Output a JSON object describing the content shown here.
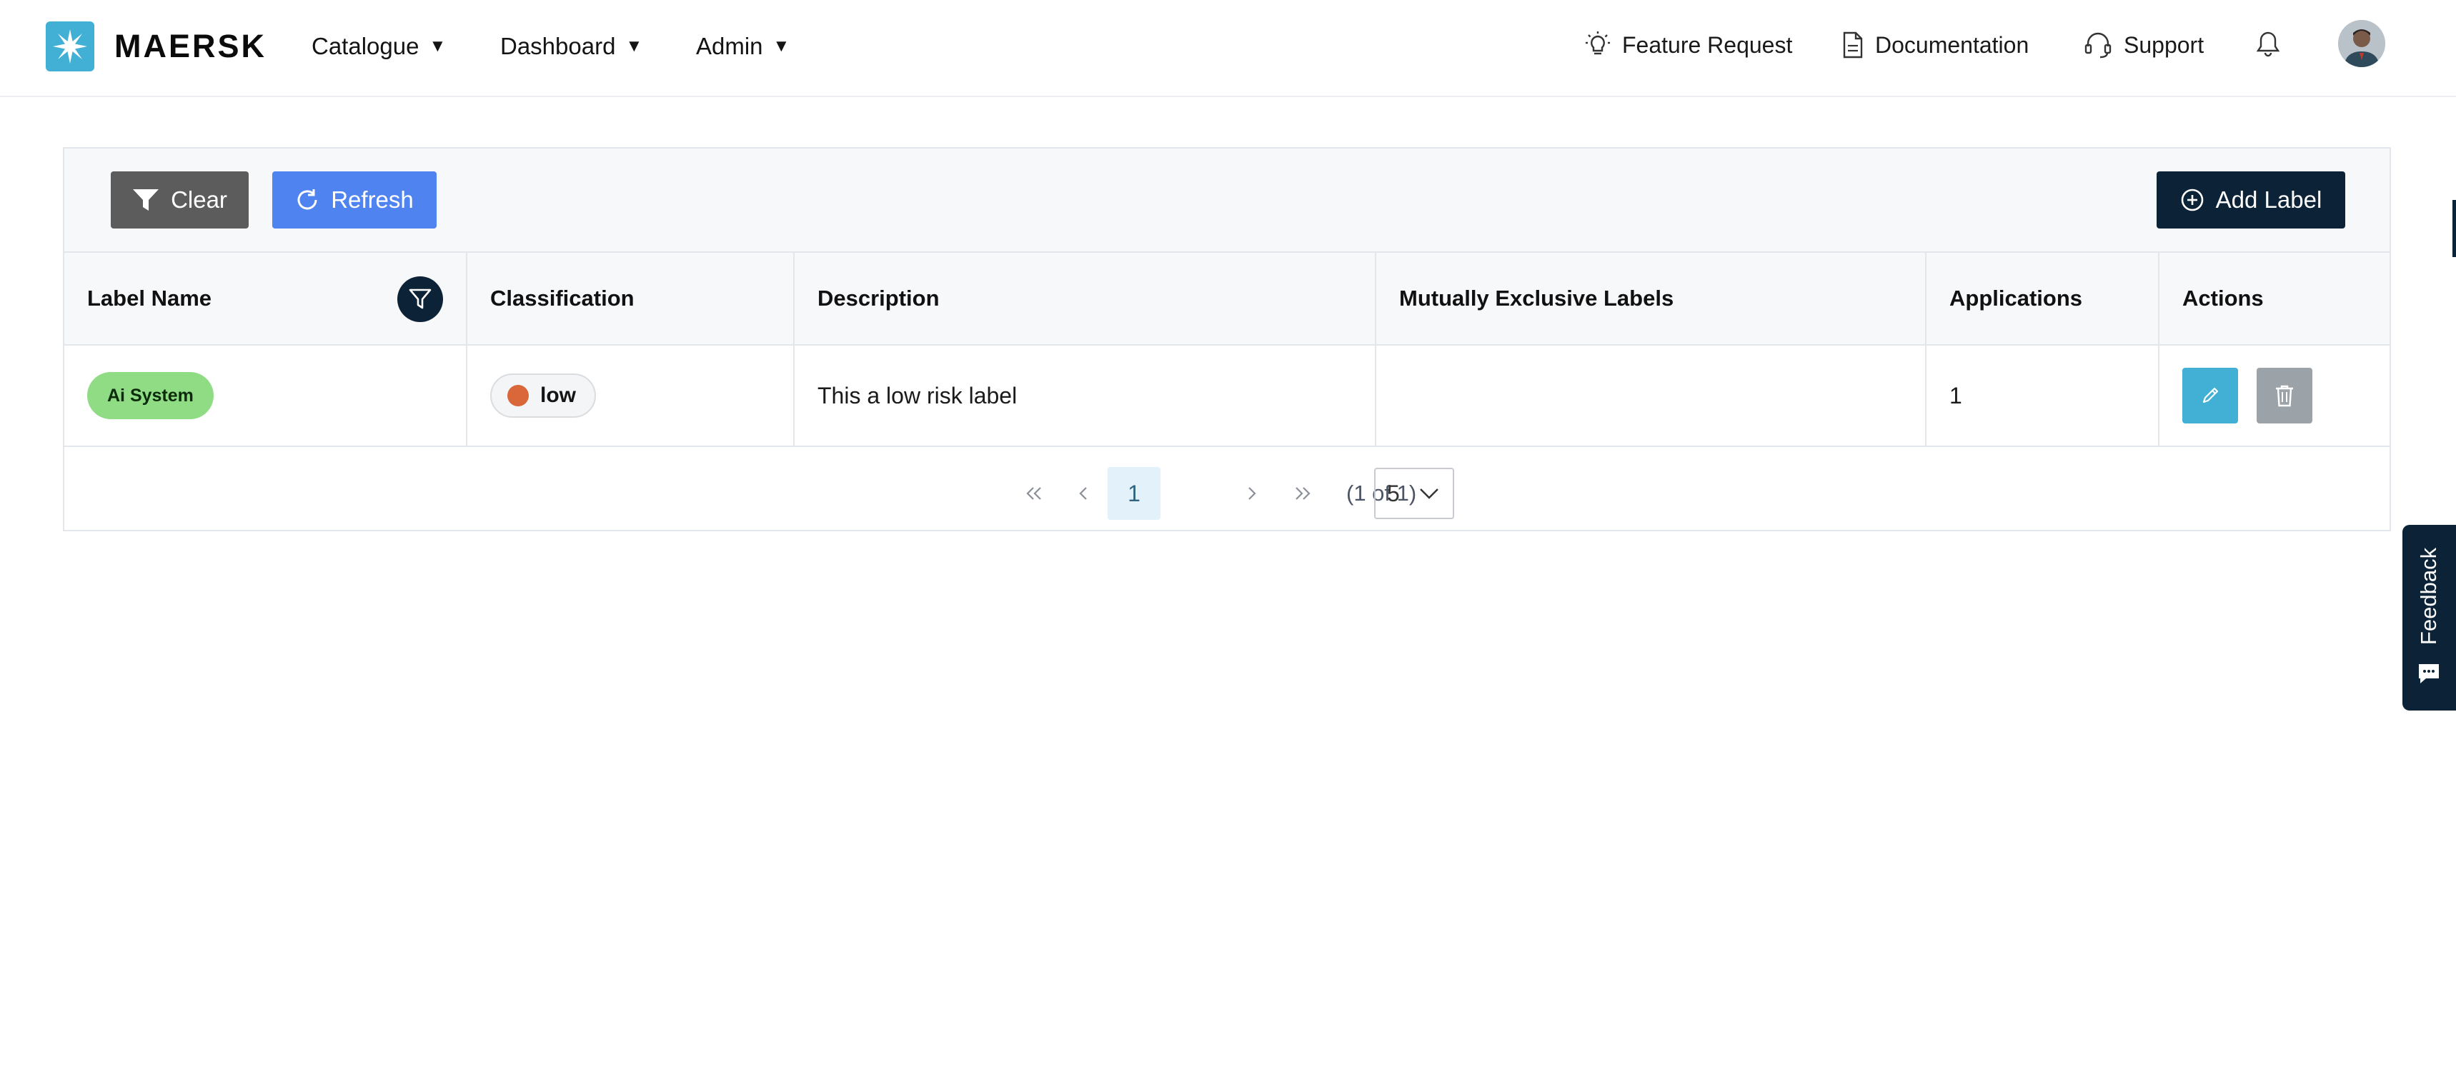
{
  "app": {
    "brand_name": "MAERSK",
    "brand_color": "#42b0d5",
    "accent_dark": "#0c2236",
    "primary_blue": "#4f83f0"
  },
  "nav": {
    "menus": [
      {
        "label": "Catalogue",
        "caret": "▼"
      },
      {
        "label": "Dashboard",
        "caret": "▼"
      },
      {
        "label": "Admin",
        "caret": "▼"
      }
    ],
    "utilities": [
      {
        "label": "Feature Request",
        "icon": "lightbulb-icon"
      },
      {
        "label": "Documentation",
        "icon": "document-icon"
      },
      {
        "label": "Support",
        "icon": "headset-icon"
      }
    ],
    "notifications_icon": "bell-icon",
    "avatar_icon": "user-avatar"
  },
  "toolbar": {
    "clear_label": "Clear",
    "refresh_label": "Refresh",
    "add_label": "Add Label"
  },
  "table": {
    "columns": [
      "Label Name",
      "Classification",
      "Description",
      "Mutually Exclusive Labels",
      "Applications",
      "Actions"
    ],
    "rows": [
      {
        "label_name": "Ai System",
        "label_color": "#8fdc85",
        "classification": "low",
        "classification_color": "#d9673a",
        "description": "This a low risk label",
        "mutually_exclusive": "",
        "applications": "1"
      }
    ]
  },
  "pagination": {
    "first": "«",
    "prev": "‹",
    "current_page": "1",
    "next": "›",
    "last": "»",
    "summary": "(1 of 1)",
    "page_size": "5"
  },
  "feedback": {
    "label": "Feedback"
  }
}
